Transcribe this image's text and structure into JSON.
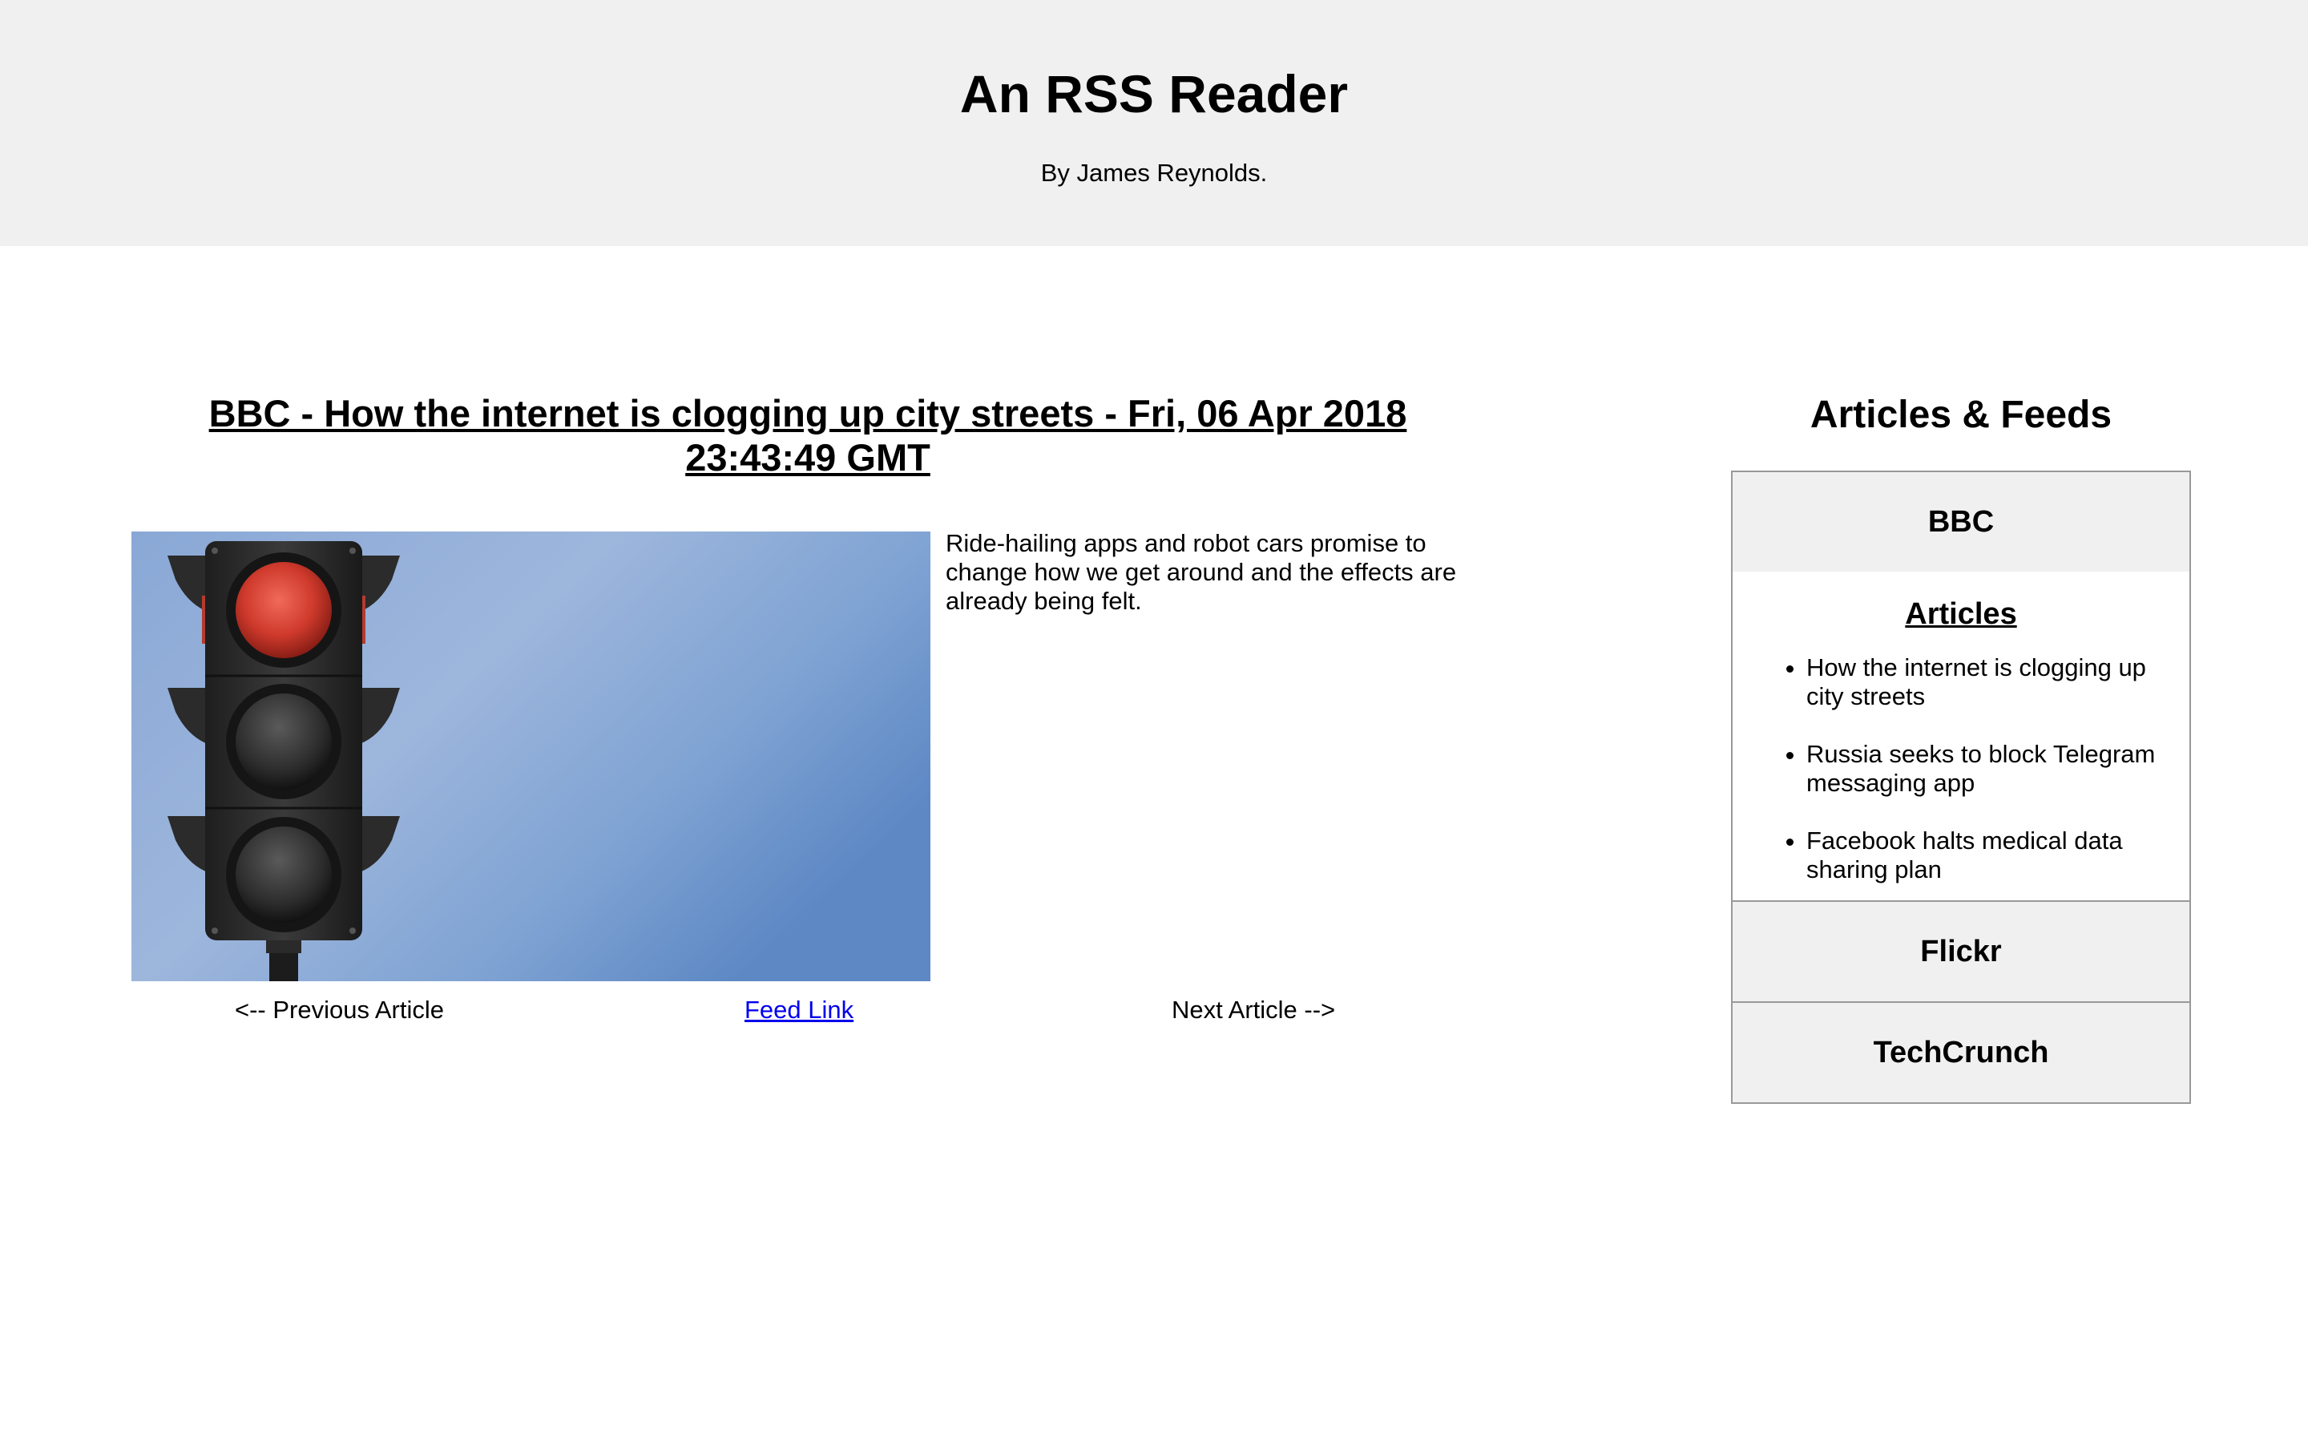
{
  "header": {
    "title": "An RSS Reader",
    "byline": "By James Reynolds."
  },
  "article": {
    "title": "BBC - How the internet is clogging up city streets - Fri, 06 Apr 2018 23:43:49 GMT",
    "description": "Ride-hailing apps and robot cars promise to change how we get around and the effects are already being felt.",
    "image_subject": "traffic-light-red"
  },
  "navigation": {
    "previous": "<-- Previous Article",
    "feed_link": "Feed Link",
    "next": "Next Article -->"
  },
  "sidebar": {
    "title": "Articles & Feeds",
    "feeds": [
      {
        "name": "BBC",
        "expanded": true,
        "articles_heading": "Articles",
        "articles": [
          "How the internet is clogging up city streets",
          "Russia seeks to block Telegram messaging app",
          "Facebook halts medical data sharing plan"
        ]
      },
      {
        "name": "Flickr",
        "expanded": false
      },
      {
        "name": "TechCrunch",
        "expanded": false
      }
    ]
  },
  "colors": {
    "header_bg": "#f0f0f0",
    "link": "#0000ee",
    "border": "#999999"
  }
}
